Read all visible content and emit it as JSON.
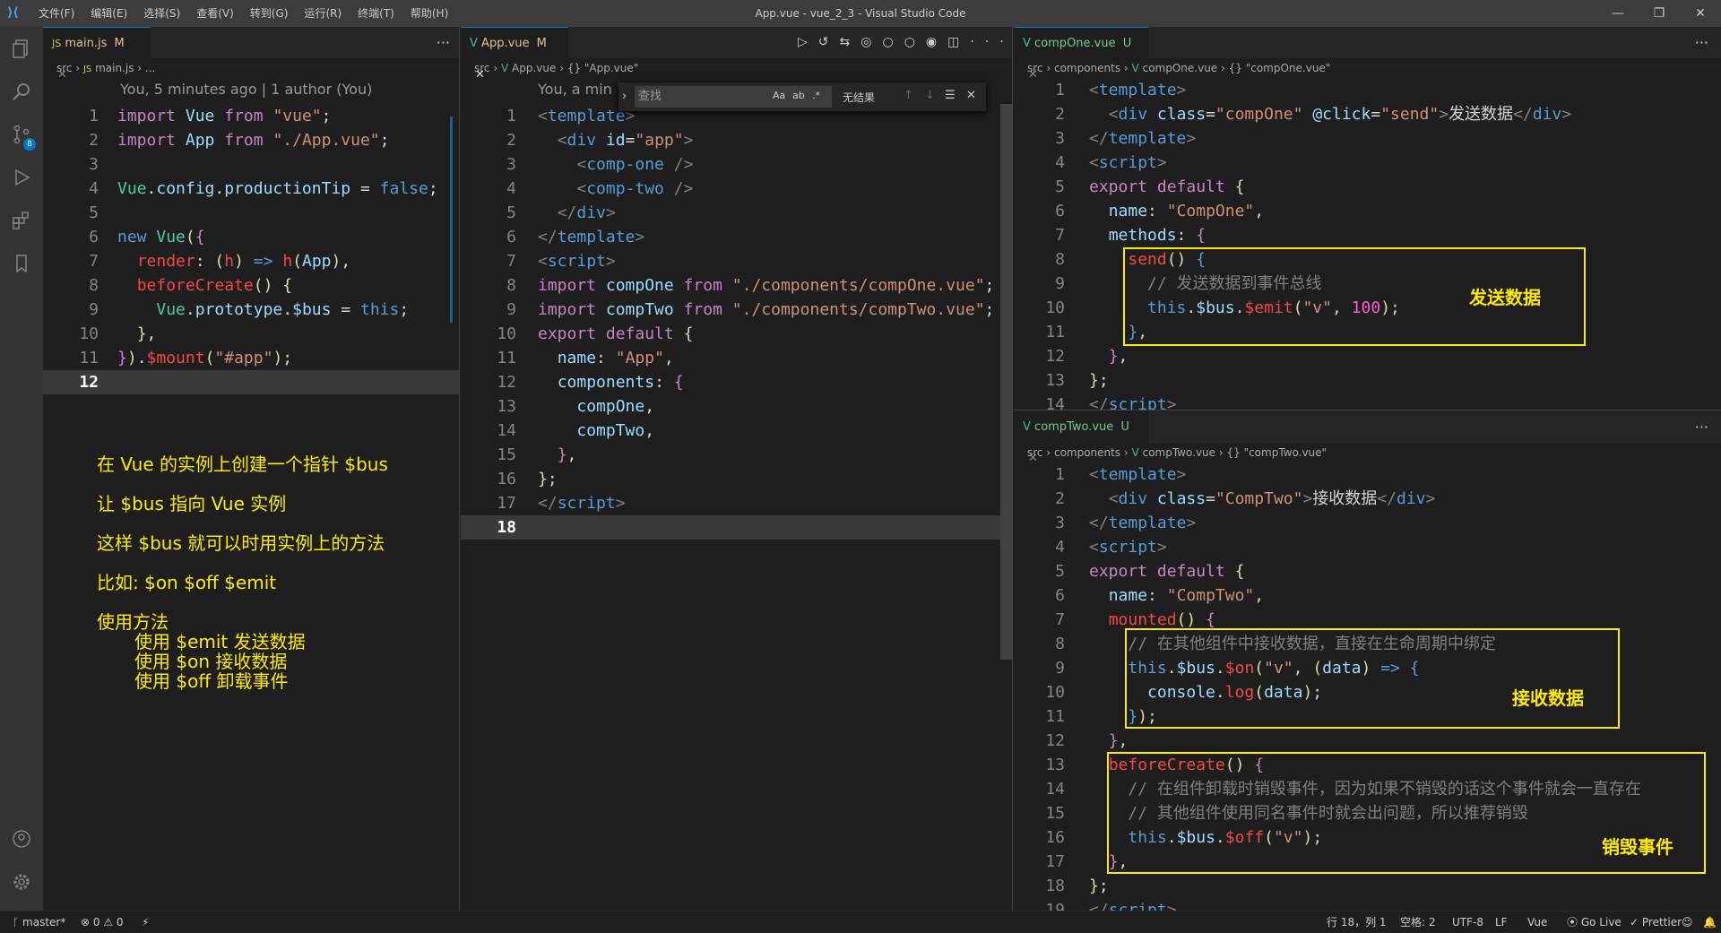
{
  "title": "App.vue - vue_2_3 - Visual Studio Code",
  "menu": [
    "文件(F)",
    "编辑(E)",
    "选择(S)",
    "查看(V)",
    "转到(G)",
    "运行(R)",
    "终端(T)",
    "帮助(H)"
  ],
  "editors": {
    "left": {
      "tab": "main.js",
      "tab_status": "M",
      "breadcrumb": [
        "src",
        "main.js",
        "..."
      ],
      "blame": "You, 5 minutes ago | 1 author (You)",
      "current_line": "12",
      "notes": [
        "在 Vue 的实例上创建一个指针 $bus",
        "让 $bus 指向 Vue 实例",
        "这样 $bus 就可以时用实例上的方法",
        "比如: $on  $off  $emit",
        "使用方法",
        "使用 $emit 发送数据",
        "使用 $on 接收数据",
        "使用 $off 卸载事件"
      ]
    },
    "middle": {
      "tab": "App.vue",
      "tab_status": "M",
      "breadcrumb": [
        "src",
        "App.vue",
        "{} \"App.vue\""
      ],
      "blame": "You, a min",
      "find_placeholder": "查找",
      "find_result": "无结果",
      "current_line": "18"
    },
    "right_top": {
      "tab": "compOne.vue",
      "tab_status": "U",
      "breadcrumb": [
        "src",
        "components",
        "compOne.vue",
        "{} \"compOne.vue\""
      ],
      "label": "发送数据"
    },
    "right_bottom": {
      "tab": "compTwo.vue",
      "tab_status": "U",
      "breadcrumb": [
        "src",
        "components",
        "compTwo.vue",
        "{} \"compTwo.vue\""
      ],
      "label_receive": "接收数据",
      "label_destroy": "销毁事件"
    }
  },
  "status": {
    "branch": "master*",
    "problems": "⊗ 0 ⚠ 0",
    "position": "行 18，列 1",
    "spaces": "空格: 2",
    "encoding": "UTF-8",
    "eol": "LF",
    "language": "Vue",
    "golive": "Go Live",
    "prettier": "Prettier"
  },
  "colors": {
    "accent": "#007acc",
    "annotation": "#ffeb00"
  }
}
